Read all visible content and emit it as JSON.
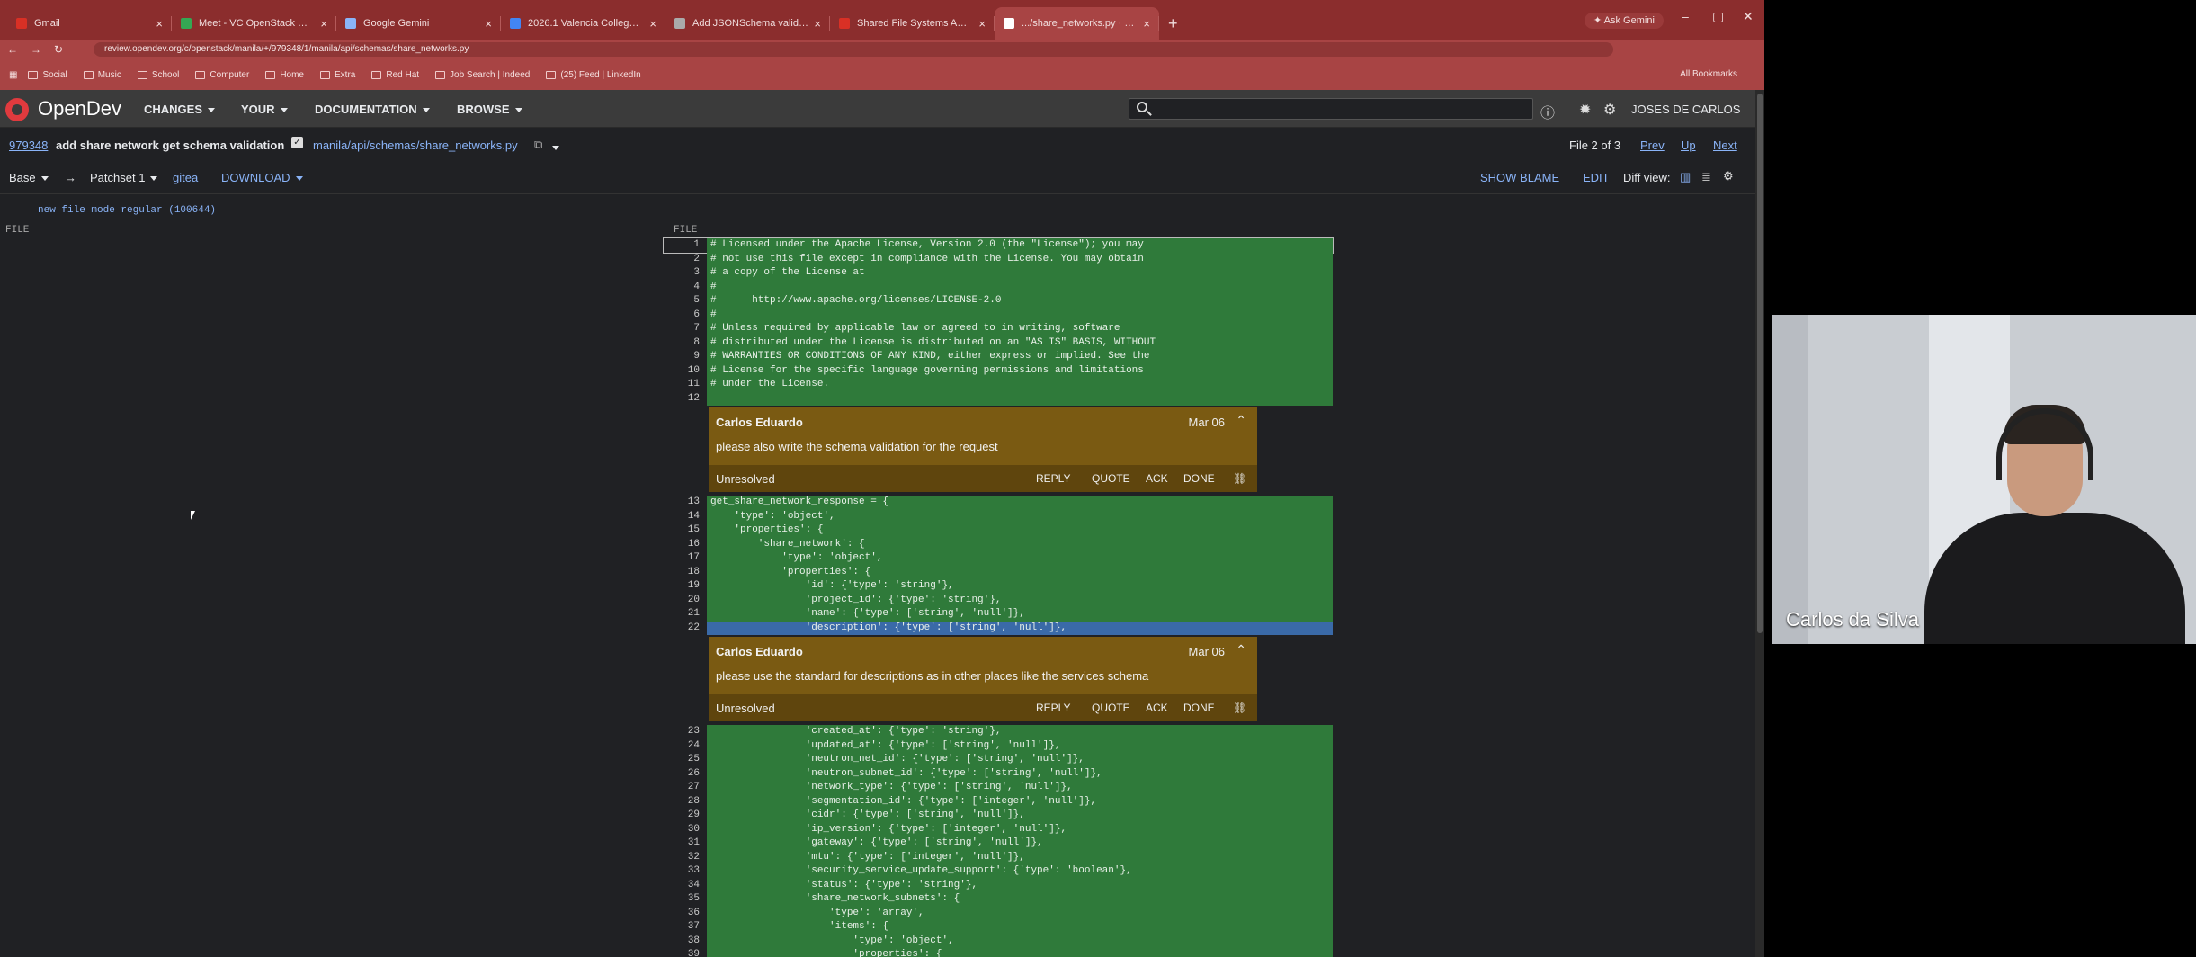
{
  "browser": {
    "tabs": [
      {
        "title": "Gmail",
        "color": "#d93025"
      },
      {
        "title": "Meet - VC OpenStack Man...",
        "color": "#34a853"
      },
      {
        "title": "Google Gemini",
        "color": "#8ab4f8"
      },
      {
        "title": "2026.1 Valencia College Manila",
        "color": "#4285f4"
      },
      {
        "title": "Add JSONSchema validation",
        "color": "#aaaaaa"
      },
      {
        "title": "Shared File Systems API — ma...",
        "color": "#d93025"
      },
      {
        "title": ".../share_networks.py · Gerrit C",
        "color": "#ffffff"
      }
    ],
    "new_tab": "+",
    "ask_gemini": "✦ Ask Gemini",
    "url": "review.opendev.org/c/openstack/manila/+/979348/1/manila/api/schemas/share_networks.py",
    "bookmarks": [
      "Social",
      "Music",
      "School",
      "Computer",
      "Home",
      "Extra",
      "Red Hat",
      "Job Search | Indeed",
      "(25) Feed | LinkedIn"
    ],
    "all_bookmarks": "All Bookmarks"
  },
  "header": {
    "brand": "OpenDev",
    "menus": [
      "CHANGES",
      "YOUR",
      "DOCUMENTATION",
      "BROWSE"
    ],
    "user": "JOSES DE CARLOS"
  },
  "change": {
    "number": "979348",
    "subject": "add share network get schema validation",
    "file_path": "manila/api/schemas/share_networks.py",
    "file_index": "File 2 of 3",
    "prev": "Prev",
    "up": "Up",
    "next": "Next",
    "base": "Base",
    "arrow": "→",
    "patchset": "Patchset 1",
    "gitea": "gitea",
    "download": "DOWNLOAD",
    "show_blame": "SHOW BLAME",
    "edit": "EDIT",
    "diff_view": "Diff view:",
    "file_mode": "new file mode regular (100644)",
    "file_label": "FILE"
  },
  "code_block1": [
    {
      "n": "1",
      "t": "# Licensed under the Apache License, Version 2.0 (the \"License\"); you may"
    },
    {
      "n": "2",
      "t": "# not use this file except in compliance with the License. You may obtain"
    },
    {
      "n": "3",
      "t": "# a copy of the License at"
    },
    {
      "n": "4",
      "t": "#"
    },
    {
      "n": "5",
      "t": "#      http://www.apache.org/licenses/LICENSE-2.0"
    },
    {
      "n": "6",
      "t": "#"
    },
    {
      "n": "7",
      "t": "# Unless required by applicable law or agreed to in writing, software"
    },
    {
      "n": "8",
      "t": "# distributed under the License is distributed on an \"AS IS\" BASIS, WITHOUT"
    },
    {
      "n": "9",
      "t": "# WARRANTIES OR CONDITIONS OF ANY KIND, either express or implied. See the"
    },
    {
      "n": "10",
      "t": "# License for the specific language governing permissions and limitations"
    },
    {
      "n": "11",
      "t": "# under the License."
    },
    {
      "n": "12",
      "t": ""
    }
  ],
  "comment1": {
    "author": "Carlos Eduardo",
    "date": "Mar 06",
    "message": "please also write the schema validation for the request",
    "status": "Unresolved",
    "actions": [
      "REPLY",
      "QUOTE",
      "ACK",
      "DONE"
    ]
  },
  "code_block2": [
    {
      "n": "13",
      "t": "get_share_network_response = {"
    },
    {
      "n": "14",
      "t": "    'type': 'object',"
    },
    {
      "n": "15",
      "t": "    'properties': {"
    },
    {
      "n": "16",
      "t": "        'share_network': {"
    },
    {
      "n": "17",
      "t": "            'type': 'object',"
    },
    {
      "n": "18",
      "t": "            'properties': {"
    },
    {
      "n": "19",
      "t": "                'id': {'type': 'string'},"
    },
    {
      "n": "20",
      "t": "                'project_id': {'type': 'string'},"
    },
    {
      "n": "21",
      "t": "                'name': {'type': ['string', 'null']},"
    },
    {
      "n": "22",
      "t": "                'description': {'type': ['string', 'null']},"
    }
  ],
  "comment2": {
    "author": "Carlos Eduardo",
    "date": "Mar 06",
    "message": "please use the standard for descriptions as in other places like the services schema",
    "status": "Unresolved",
    "actions": [
      "REPLY",
      "QUOTE",
      "ACK",
      "DONE"
    ]
  },
  "code_block3": [
    {
      "n": "23",
      "t": "                'created_at': {'type': 'string'},"
    },
    {
      "n": "24",
      "t": "                'updated_at': {'type': ['string', 'null']},"
    },
    {
      "n": "25",
      "t": "                'neutron_net_id': {'type': ['string', 'null']},"
    },
    {
      "n": "26",
      "t": "                'neutron_subnet_id': {'type': ['string', 'null']},"
    },
    {
      "n": "27",
      "t": "                'network_type': {'type': ['string', 'null']},"
    },
    {
      "n": "28",
      "t": "                'segmentation_id': {'type': ['integer', 'null']},"
    },
    {
      "n": "29",
      "t": "                'cidr': {'type': ['string', 'null']},"
    },
    {
      "n": "30",
      "t": "                'ip_version': {'type': ['integer', 'null']},"
    },
    {
      "n": "31",
      "t": "                'gateway': {'type': ['string', 'null']},"
    },
    {
      "n": "32",
      "t": "                'mtu': {'type': ['integer', 'null']},"
    },
    {
      "n": "33",
      "t": "                'security_service_update_support': {'type': 'boolean'},"
    },
    {
      "n": "34",
      "t": "                'status': {'type': 'string'},"
    },
    {
      "n": "35",
      "t": "                'share_network_subnets': {"
    },
    {
      "n": "36",
      "t": "                    'type': 'array',"
    },
    {
      "n": "37",
      "t": "                    'items': {"
    },
    {
      "n": "38",
      "t": "                        'type': 'object',"
    },
    {
      "n": "39",
      "t": "                        'properties': {"
    }
  ],
  "video": {
    "name": "Carlos da Silva"
  }
}
